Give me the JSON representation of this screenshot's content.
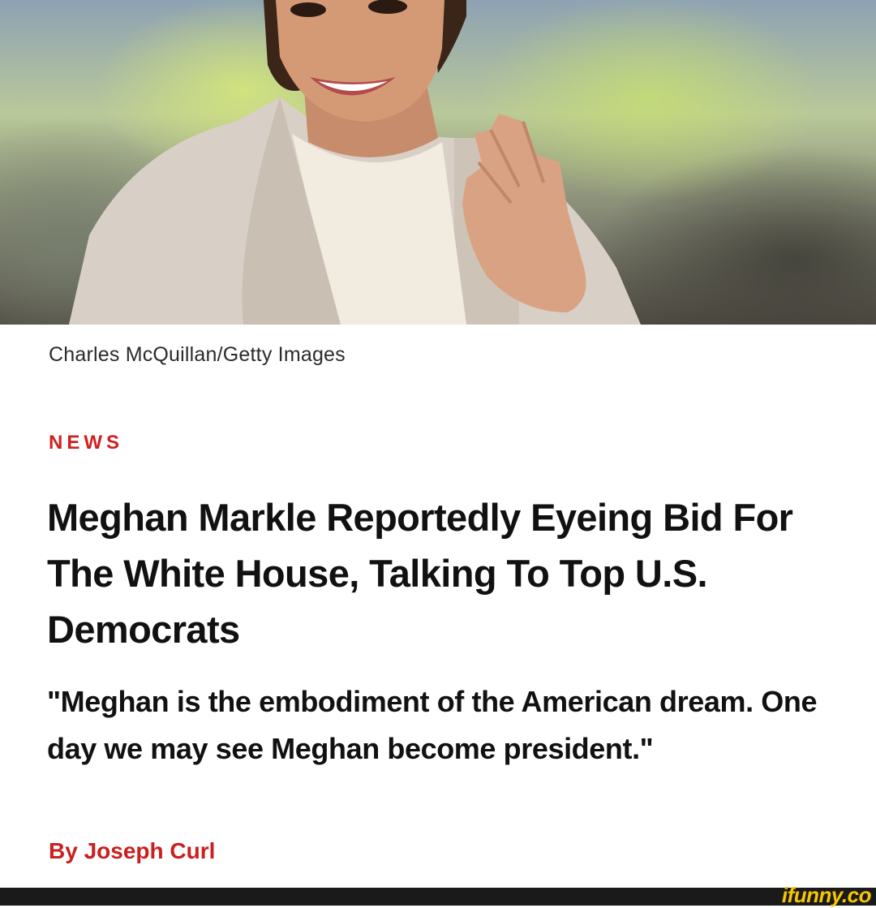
{
  "article": {
    "photo_credit": "Charles McQuillan/Getty Images",
    "section": "NEWS",
    "headline": "Meghan Markle Reportedly Eyeing Bid For The White House, Talking To Top U.S. Democrats",
    "quote": "\"Meghan is the embodiment of the American dream. One day we may see Meghan become president.\"",
    "byline": "By Joseph Curl"
  },
  "watermark": {
    "text": "ifunny.co"
  },
  "colors": {
    "accent_red": "#d0201f",
    "headline": "#111111",
    "watermark": "#f7c600"
  }
}
